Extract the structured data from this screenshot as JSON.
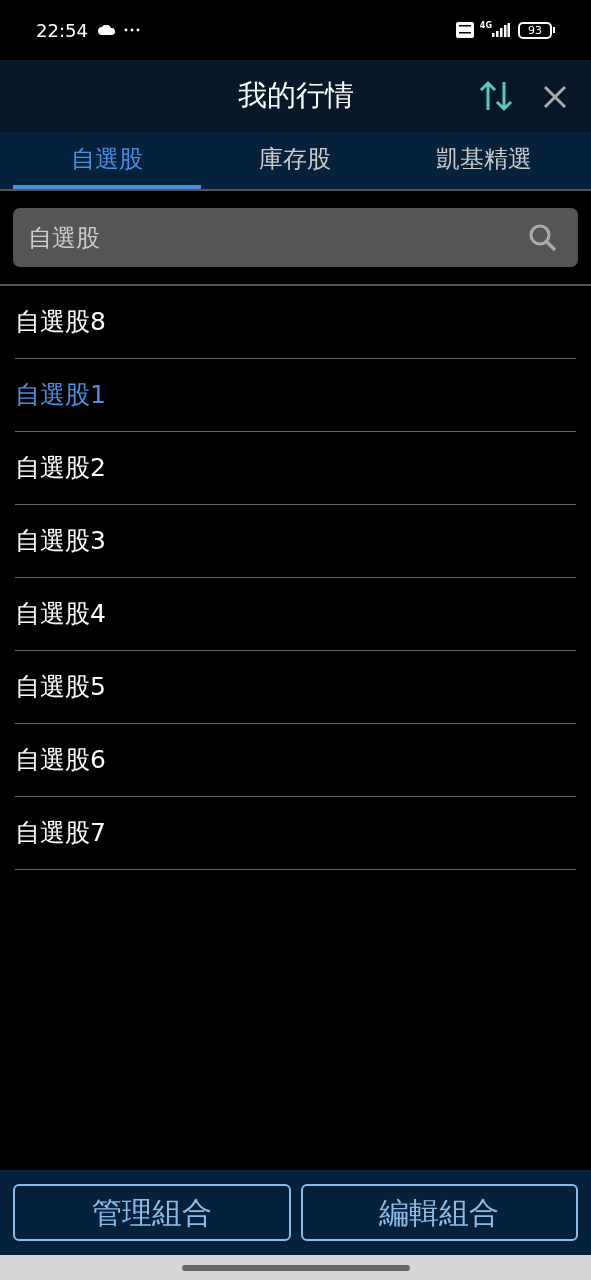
{
  "status_bar": {
    "time": "22:54",
    "network": "4G",
    "battery": "93"
  },
  "header": {
    "title": "我的行情"
  },
  "tabs": [
    {
      "label": "自選股",
      "selected": true
    },
    {
      "label": "庫存股",
      "selected": false
    },
    {
      "label": "凱基精選",
      "selected": false
    }
  ],
  "search": {
    "placeholder": "自選股"
  },
  "groups": [
    {
      "label": "自選股8",
      "selected": false
    },
    {
      "label": "自選股1",
      "selected": true
    },
    {
      "label": "自選股2",
      "selected": false
    },
    {
      "label": "自選股3",
      "selected": false
    },
    {
      "label": "自選股4",
      "selected": false
    },
    {
      "label": "自選股5",
      "selected": false
    },
    {
      "label": "自選股6",
      "selected": false
    },
    {
      "label": "自選股7",
      "selected": false
    }
  ],
  "buttons": [
    "管理組合",
    "編輯組合"
  ]
}
